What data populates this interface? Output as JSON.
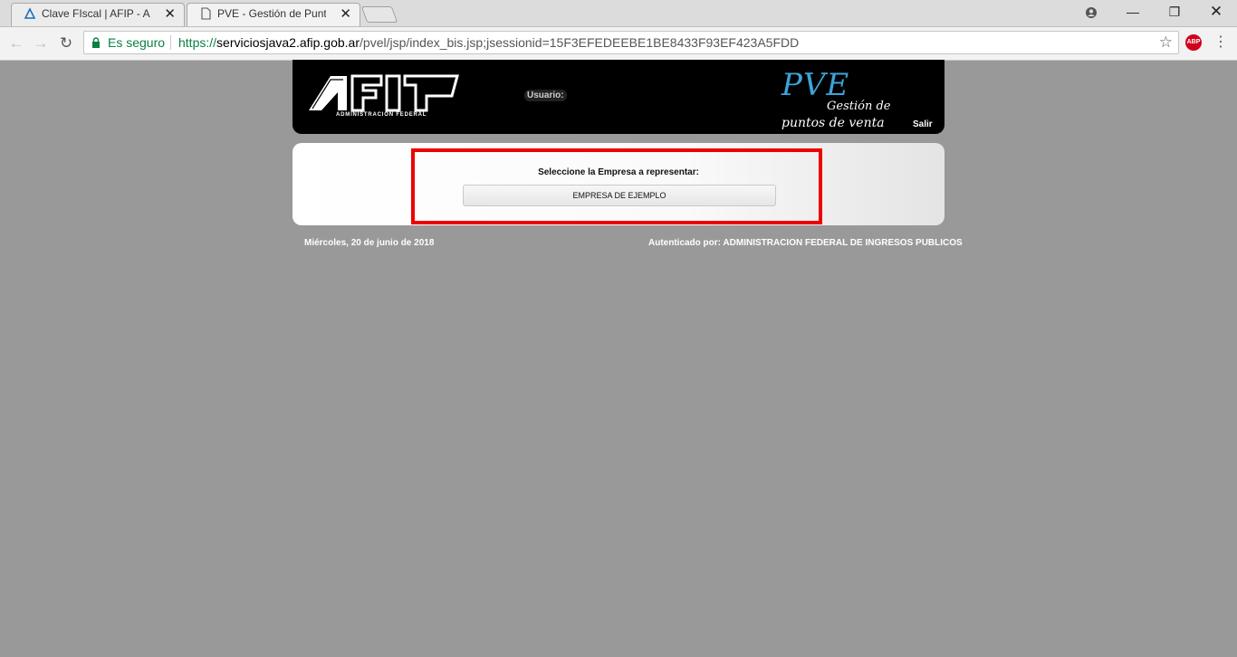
{
  "browser": {
    "tabs": [
      {
        "title": "Clave FIscal | AFIP - Admi",
        "active": false
      },
      {
        "title": "PVE - Gestión de Puntos d",
        "active": true
      }
    ],
    "address": {
      "secure_label": "Es seguro",
      "url_scheme": "https://",
      "url_host": "serviciosjava2.afip.gob.ar",
      "url_path": "/pvel/jsp/index_bis.jsp;jsessionid=15F3EFEDEEBE1BE8433F93EF423A5FDD"
    },
    "extension_label": "ABP"
  },
  "header": {
    "logo_text": "AFIP",
    "logo_subtitle": "ADMINISTRACION FEDERAL",
    "usuario_label": "Usuario:",
    "app_name": "PVE",
    "app_subtitle_1": "Gestión de",
    "app_subtitle_2": "puntos de venta",
    "salir_label": "Salir"
  },
  "main": {
    "prompt": "Seleccione la Empresa a representar:",
    "empresa_button": "EMPRESA DE EJEMPLO"
  },
  "footer": {
    "date": "Miércoles, 20 de junio de 2018",
    "auth_prefix": "Autenticado por:",
    "auth_entity": "ADMINISTRACION FEDERAL DE INGRESOS PUBLICOS"
  },
  "colors": {
    "page_bg": "#999999",
    "highlight": "#ee0000",
    "pve_blue": "#3ea3d8"
  }
}
